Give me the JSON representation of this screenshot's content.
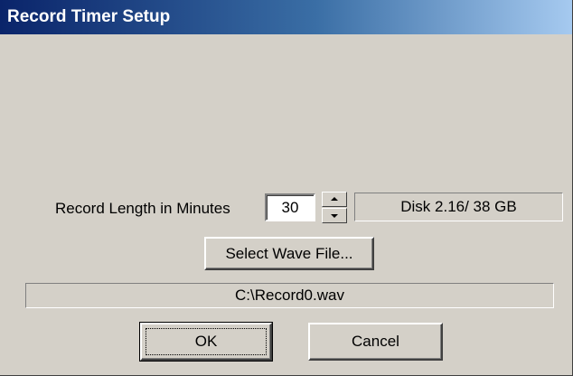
{
  "window": {
    "title": "Record Timer Setup"
  },
  "record_length": {
    "label": "Record Length in Minutes",
    "value": "30"
  },
  "disk": {
    "text": "Disk 2.16/ 38 GB"
  },
  "select_wave": {
    "label": "Select Wave File..."
  },
  "file_path": {
    "text": "C:\\Record0.wav"
  },
  "buttons": {
    "ok": "OK",
    "cancel": "Cancel"
  },
  "icons": {
    "spin_up": "arrow-up-icon",
    "spin_down": "arrow-down-icon"
  },
  "colors": {
    "face": "#d4d0c8",
    "title_start": "#0a246a",
    "title_end": "#a6caf0"
  }
}
